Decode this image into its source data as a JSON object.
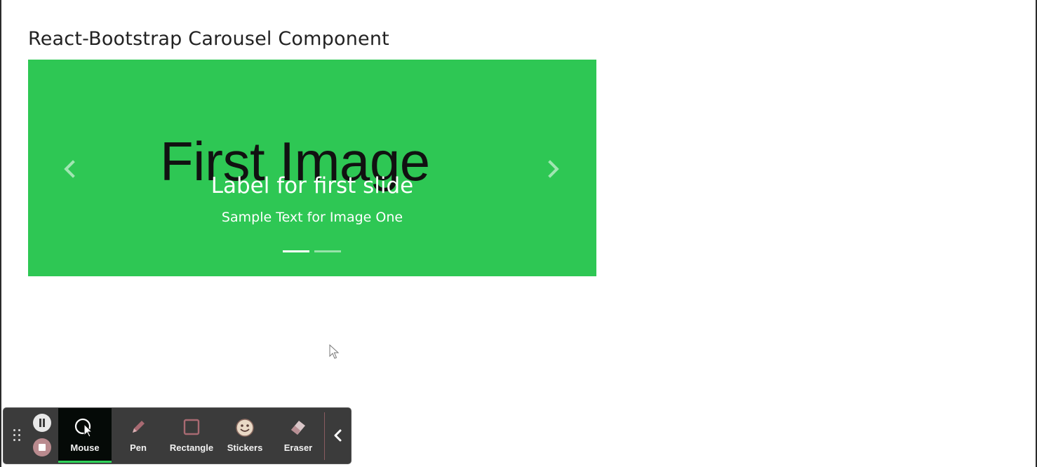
{
  "page": {
    "heading": "React-Bootstrap Carousel Component"
  },
  "carousel": {
    "background_color": "#2ec754",
    "slide": {
      "image_text": "First Image",
      "caption_title": "Label for first slide",
      "caption_text": "Sample Text for Image One"
    },
    "indicator_count": 2,
    "active_indicator": 1,
    "prev_icon": "chevron-left-icon",
    "next_icon": "chevron-right-icon"
  },
  "toolbar": {
    "accent_color": "#2fd35a",
    "controls": [
      "drag-handle-icon",
      "pause-icon",
      "stop-icon"
    ],
    "tools": [
      {
        "label": "Mouse",
        "icon": "mouse-cursor-icon",
        "active": true
      },
      {
        "label": "Pen",
        "icon": "pen-icon",
        "active": false
      },
      {
        "label": "Rectangle",
        "icon": "rectangle-icon",
        "active": false
      },
      {
        "label": "Stickers",
        "icon": "sticker-icon",
        "active": false
      },
      {
        "label": "Eraser",
        "icon": "eraser-icon",
        "active": false
      }
    ],
    "collapse_icon": "chevron-left-icon"
  }
}
